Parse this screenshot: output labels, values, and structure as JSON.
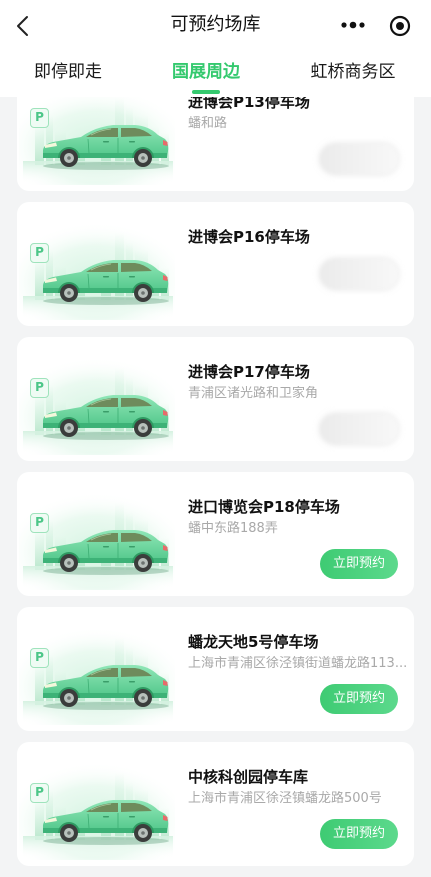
{
  "header": {
    "title": "可预约场库",
    "back_icon": "chevron-left-icon",
    "more_icon": "more-dots-icon",
    "target_icon": "target-circle-icon"
  },
  "tabs": [
    {
      "label": "即停即走",
      "active": false
    },
    {
      "label": "国展周边",
      "active": true
    },
    {
      "label": "虹桥商务区",
      "active": false
    }
  ],
  "colors": {
    "accent": "#34c96e",
    "button": "#3ecb73",
    "address_text": "#a9a9a9",
    "page_background": "#f3f4f5"
  },
  "lot_image": {
    "icon": "parking-icon",
    "sign_text": "P",
    "illustration": "car-illustration"
  },
  "lots": [
    {
      "name": "进博会P13停车场",
      "address": "蟠和路",
      "button_enabled": false
    },
    {
      "name": "进博会P16停车场",
      "button_enabled": false
    },
    {
      "name": "进博会P17停车场",
      "address": "青浦区诸光路和卫家角",
      "button_enabled": false
    },
    {
      "name": "进口博览会P18停车场",
      "address": "蟠中东路188弄",
      "button_enabled": true,
      "button_label": "立即预约"
    },
    {
      "name": "蟠龙天地5号停车场",
      "address": "上海市青浦区徐泾镇街道蟠龙路113...",
      "button_enabled": true,
      "button_label": "立即预约"
    },
    {
      "name": "中核科创园停车库",
      "address": "上海市青浦区徐泾镇蟠龙路500号",
      "button_enabled": true,
      "button_label": "立即预约"
    }
  ]
}
